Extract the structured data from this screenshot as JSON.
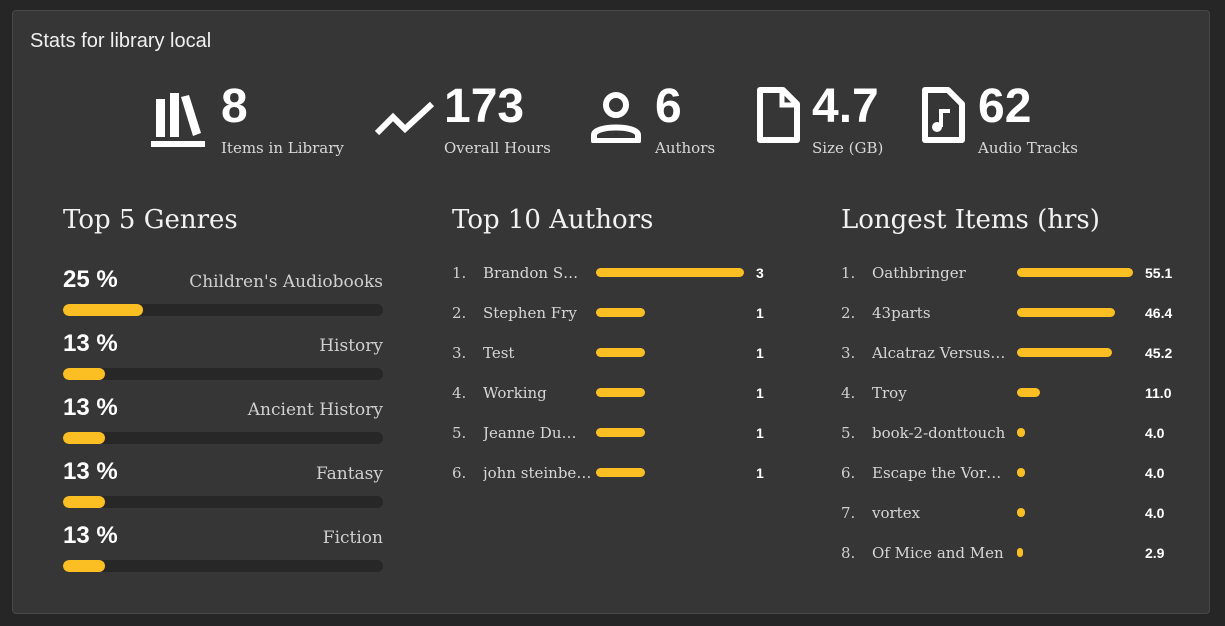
{
  "title": "Stats for library local",
  "stats": [
    {
      "icon": "books-icon",
      "value": "8",
      "label": "Items in Library"
    },
    {
      "icon": "trending-up-icon",
      "value": "173",
      "label": "Overall Hours"
    },
    {
      "icon": "person-icon",
      "value": "6",
      "label": "Authors"
    },
    {
      "icon": "file-icon",
      "value": "4.7",
      "label": "Size (GB)"
    },
    {
      "icon": "audio-file-icon",
      "value": "62",
      "label": "Audio Tracks"
    }
  ],
  "genres": {
    "title": "Top 5 Genres",
    "items": [
      {
        "percent_label": "25 %",
        "name": "Children's Audiobooks",
        "fraction": 0.25
      },
      {
        "percent_label": "13 %",
        "name": "History",
        "fraction": 0.13
      },
      {
        "percent_label": "13 %",
        "name": "Ancient History",
        "fraction": 0.13
      },
      {
        "percent_label": "13 %",
        "name": "Fantasy",
        "fraction": 0.13
      },
      {
        "percent_label": "13 %",
        "name": "Fiction",
        "fraction": 0.13
      }
    ]
  },
  "authors": {
    "title": "Top 10 Authors",
    "items": [
      {
        "rank": "1.",
        "name": "Brandon Sa...",
        "value": "3",
        "count": 3
      },
      {
        "rank": "2.",
        "name": "Stephen Fry",
        "value": "1",
        "count": 1
      },
      {
        "rank": "3.",
        "name": "Test",
        "value": "1",
        "count": 1
      },
      {
        "rank": "4.",
        "name": "Working",
        "value": "1",
        "count": 1
      },
      {
        "rank": "5.",
        "name": "Jeanne DuPr...",
        "value": "1",
        "count": 1
      },
      {
        "rank": "6.",
        "name": "john steinbeck",
        "value": "1",
        "count": 1
      }
    ]
  },
  "longest": {
    "title": "Longest Items (hrs)",
    "items": [
      {
        "rank": "1.",
        "name": "Oathbringer",
        "value": "55.1",
        "hours": 55.1
      },
      {
        "rank": "2.",
        "name": "43parts",
        "value": "46.4",
        "hours": 46.4
      },
      {
        "rank": "3.",
        "name": "Alcatraz Versus ...",
        "value": "45.2",
        "hours": 45.2
      },
      {
        "rank": "4.",
        "name": "Troy",
        "value": "11.0",
        "hours": 11.0
      },
      {
        "rank": "5.",
        "name": "book-2-donttouch",
        "value": "4.0",
        "hours": 4.0
      },
      {
        "rank": "6.",
        "name": "Escape the Vortex",
        "value": "4.0",
        "hours": 4.0
      },
      {
        "rank": "7.",
        "name": "vortex",
        "value": "4.0",
        "hours": 4.0
      },
      {
        "rank": "8.",
        "name": "Of Mice and Men",
        "value": "2.9",
        "hours": 2.9
      }
    ]
  },
  "colors": {
    "accent": "#fbbf24",
    "panel": "#363636",
    "track": "#272727"
  }
}
